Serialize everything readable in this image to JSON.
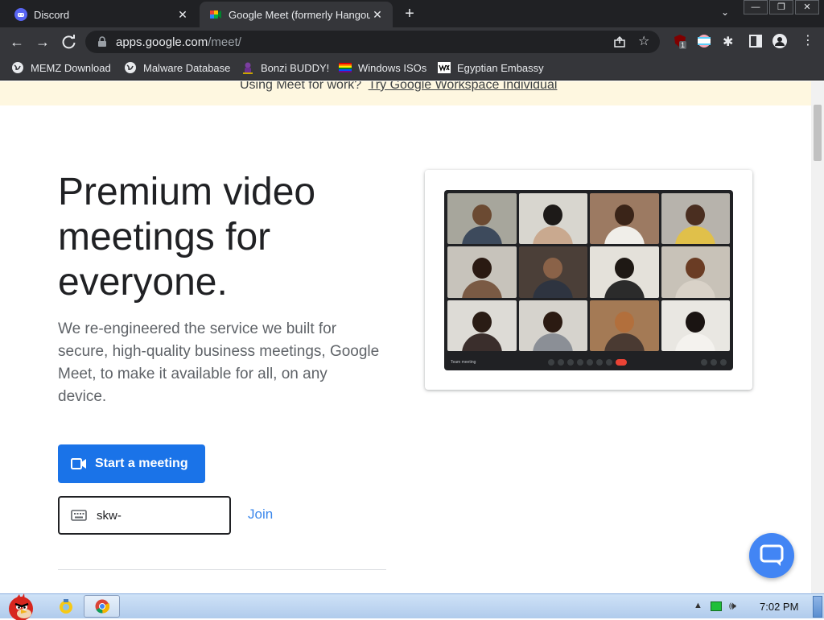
{
  "browser": {
    "tabs": [
      {
        "title": "Discord",
        "favicon": "discord-icon",
        "active": false
      },
      {
        "title": "Google Meet (formerly Hangouts)",
        "favicon": "google-meet-icon",
        "active": true
      }
    ],
    "new_tab": "+",
    "tab_menu": "⌄",
    "window_controls": [
      "—",
      "❐",
      "✕"
    ],
    "url_host": "apps.google.com",
    "url_path": "/meet/",
    "extension_badge": "1",
    "bookmarks": [
      {
        "label": "MEMZ Download",
        "icon": "globe-icon"
      },
      {
        "label": "Malware Database",
        "icon": "globe-icon"
      },
      {
        "label": "Bonzi BUDDY!",
        "icon": "bonzi-icon"
      },
      {
        "label": "Windows ISOs",
        "icon": "rainbow-flag-icon"
      },
      {
        "label": "Egyptian Embassy",
        "icon": "wix-icon"
      }
    ]
  },
  "page": {
    "banner_prefix": "Using Meet for work?",
    "banner_link": "Try Google Workspace Individual",
    "headline": "Premium video meetings for everyone.",
    "description": "We re-engineered the service we built for secure, high-quality business meetings, Google Meet, to make it available for all, on any device.",
    "start_button": "Start a meeting",
    "code_input_value": "skw-",
    "join_label": "Join",
    "meeting_name": "Team meeting"
  },
  "taskbar": {
    "clock": "7:02 PM"
  },
  "colors": {
    "accent": "#1a73e8",
    "banner_bg": "#fef7e0",
    "chrome_dark": "#202124",
    "chrome_toolbar": "#35363a"
  }
}
